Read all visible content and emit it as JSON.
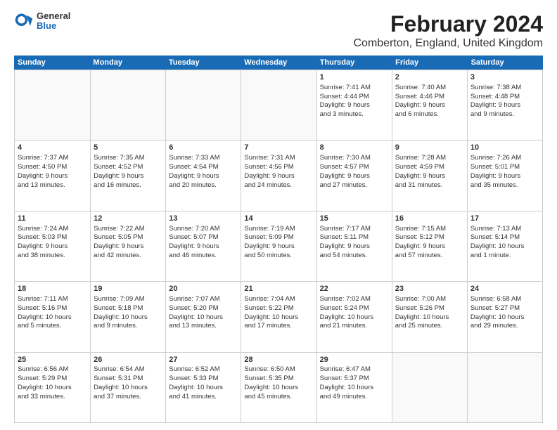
{
  "logo": {
    "line1": "General",
    "line2": "Blue"
  },
  "title": "February 2024",
  "subtitle": "Comberton, England, United Kingdom",
  "days": [
    "Sunday",
    "Monday",
    "Tuesday",
    "Wednesday",
    "Thursday",
    "Friday",
    "Saturday"
  ],
  "weeks": [
    [
      {
        "day": "",
        "content": ""
      },
      {
        "day": "",
        "content": ""
      },
      {
        "day": "",
        "content": ""
      },
      {
        "day": "",
        "content": ""
      },
      {
        "day": "1",
        "content": "Sunrise: 7:41 AM\nSunset: 4:44 PM\nDaylight: 9 hours\nand 3 minutes."
      },
      {
        "day": "2",
        "content": "Sunrise: 7:40 AM\nSunset: 4:46 PM\nDaylight: 9 hours\nand 6 minutes."
      },
      {
        "day": "3",
        "content": "Sunrise: 7:38 AM\nSunset: 4:48 PM\nDaylight: 9 hours\nand 9 minutes."
      }
    ],
    [
      {
        "day": "4",
        "content": "Sunrise: 7:37 AM\nSunset: 4:50 PM\nDaylight: 9 hours\nand 13 minutes."
      },
      {
        "day": "5",
        "content": "Sunrise: 7:35 AM\nSunset: 4:52 PM\nDaylight: 9 hours\nand 16 minutes."
      },
      {
        "day": "6",
        "content": "Sunrise: 7:33 AM\nSunset: 4:54 PM\nDaylight: 9 hours\nand 20 minutes."
      },
      {
        "day": "7",
        "content": "Sunrise: 7:31 AM\nSunset: 4:56 PM\nDaylight: 9 hours\nand 24 minutes."
      },
      {
        "day": "8",
        "content": "Sunrise: 7:30 AM\nSunset: 4:57 PM\nDaylight: 9 hours\nand 27 minutes."
      },
      {
        "day": "9",
        "content": "Sunrise: 7:28 AM\nSunset: 4:59 PM\nDaylight: 9 hours\nand 31 minutes."
      },
      {
        "day": "10",
        "content": "Sunrise: 7:26 AM\nSunset: 5:01 PM\nDaylight: 9 hours\nand 35 minutes."
      }
    ],
    [
      {
        "day": "11",
        "content": "Sunrise: 7:24 AM\nSunset: 5:03 PM\nDaylight: 9 hours\nand 38 minutes."
      },
      {
        "day": "12",
        "content": "Sunrise: 7:22 AM\nSunset: 5:05 PM\nDaylight: 9 hours\nand 42 minutes."
      },
      {
        "day": "13",
        "content": "Sunrise: 7:20 AM\nSunset: 5:07 PM\nDaylight: 9 hours\nand 46 minutes."
      },
      {
        "day": "14",
        "content": "Sunrise: 7:19 AM\nSunset: 5:09 PM\nDaylight: 9 hours\nand 50 minutes."
      },
      {
        "day": "15",
        "content": "Sunrise: 7:17 AM\nSunset: 5:11 PM\nDaylight: 9 hours\nand 54 minutes."
      },
      {
        "day": "16",
        "content": "Sunrise: 7:15 AM\nSunset: 5:12 PM\nDaylight: 9 hours\nand 57 minutes."
      },
      {
        "day": "17",
        "content": "Sunrise: 7:13 AM\nSunset: 5:14 PM\nDaylight: 10 hours\nand 1 minute."
      }
    ],
    [
      {
        "day": "18",
        "content": "Sunrise: 7:11 AM\nSunset: 5:16 PM\nDaylight: 10 hours\nand 5 minutes."
      },
      {
        "day": "19",
        "content": "Sunrise: 7:09 AM\nSunset: 5:18 PM\nDaylight: 10 hours\nand 9 minutes."
      },
      {
        "day": "20",
        "content": "Sunrise: 7:07 AM\nSunset: 5:20 PM\nDaylight: 10 hours\nand 13 minutes."
      },
      {
        "day": "21",
        "content": "Sunrise: 7:04 AM\nSunset: 5:22 PM\nDaylight: 10 hours\nand 17 minutes."
      },
      {
        "day": "22",
        "content": "Sunrise: 7:02 AM\nSunset: 5:24 PM\nDaylight: 10 hours\nand 21 minutes."
      },
      {
        "day": "23",
        "content": "Sunrise: 7:00 AM\nSunset: 5:26 PM\nDaylight: 10 hours\nand 25 minutes."
      },
      {
        "day": "24",
        "content": "Sunrise: 6:58 AM\nSunset: 5:27 PM\nDaylight: 10 hours\nand 29 minutes."
      }
    ],
    [
      {
        "day": "25",
        "content": "Sunrise: 6:56 AM\nSunset: 5:29 PM\nDaylight: 10 hours\nand 33 minutes."
      },
      {
        "day": "26",
        "content": "Sunrise: 6:54 AM\nSunset: 5:31 PM\nDaylight: 10 hours\nand 37 minutes."
      },
      {
        "day": "27",
        "content": "Sunrise: 6:52 AM\nSunset: 5:33 PM\nDaylight: 10 hours\nand 41 minutes."
      },
      {
        "day": "28",
        "content": "Sunrise: 6:50 AM\nSunset: 5:35 PM\nDaylight: 10 hours\nand 45 minutes."
      },
      {
        "day": "29",
        "content": "Sunrise: 6:47 AM\nSunset: 5:37 PM\nDaylight: 10 hours\nand 49 minutes."
      },
      {
        "day": "",
        "content": ""
      },
      {
        "day": "",
        "content": ""
      }
    ]
  ]
}
